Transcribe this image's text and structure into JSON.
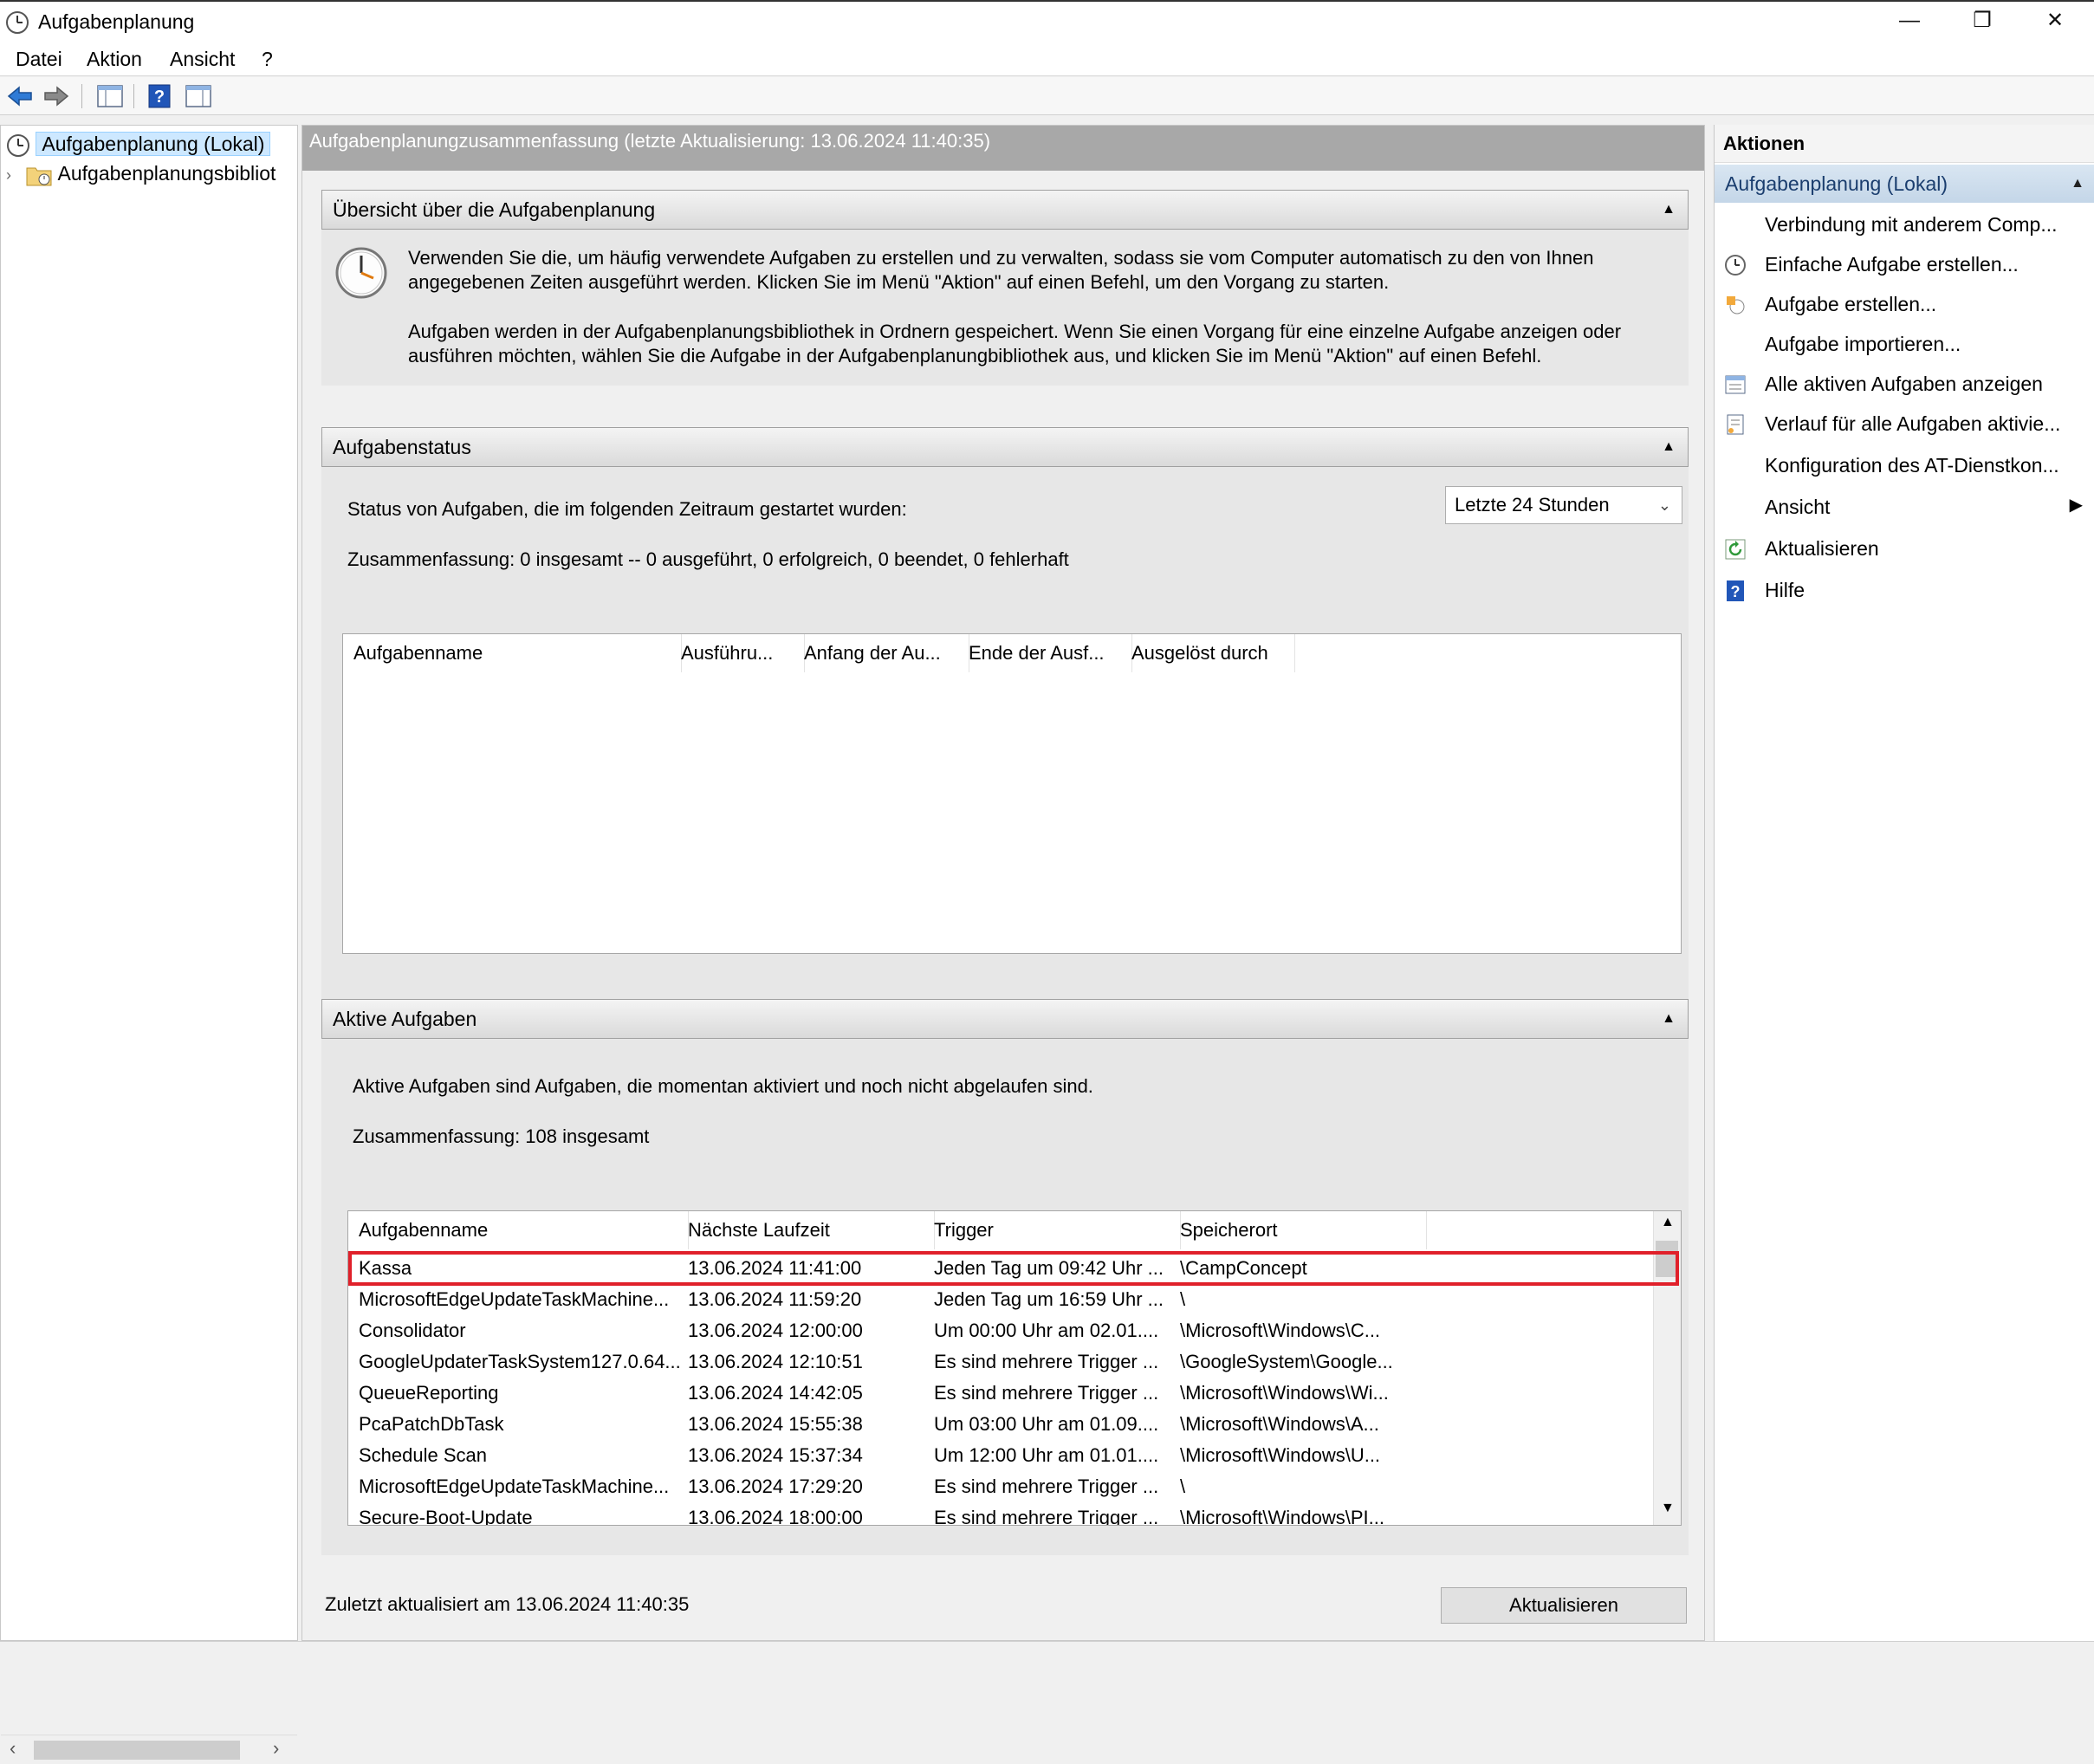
{
  "window": {
    "title": "Aufgabenplanung",
    "minimize": "—",
    "maximize": "❐",
    "close": "✕"
  },
  "menu": [
    "Datei",
    "Aktion",
    "Ansicht",
    "?"
  ],
  "tree": {
    "root": "Aufgabenplanung (Lokal)",
    "library": "Aufgabenplanungsbibliot"
  },
  "center": {
    "header": "Aufgabenplanungzusammenfassung (letzte Aktualisierung: 13.06.2024 11:40:35)",
    "overview": {
      "title": "Übersicht über die Aufgabenplanung",
      "text1a": "Verwenden Sie die, um häufig verwendete Aufgaben zu erstellen und zu verwalten, sodass sie vom Computer automatisch zu den von Ihnen",
      "text1b": "angegebenen Zeiten ausgeführt werden. Klicken Sie im Menü \"Aktion\" auf einen Befehl, um den Vorgang zu starten.",
      "text2a": "Aufgaben werden in der Aufgabenplanungsbibliothek in Ordnern gespeichert. Wenn Sie einen Vorgang für eine einzelne Aufgabe anzeigen oder",
      "text2b": "ausführen möchten, wählen Sie die Aufgabe in der Aufgabenplanungbibliothek aus, und klicken Sie im Menü \"Aktion\" auf einen Befehl."
    },
    "status": {
      "title": "Aufgabenstatus",
      "period_label": "Status von Aufgaben, die im folgenden Zeitraum gestartet wurden:",
      "period_value": "Letzte 24 Stunden",
      "summary": "Zusammenfassung: 0 insgesamt -- 0 ausgeführt, 0 erfolgreich, 0 beendet, 0 fehlerhaft",
      "columns": [
        "Aufgabenname",
        "Ausführu...",
        "Anfang der Au...",
        "Ende der Ausf...",
        "Ausgelöst durch"
      ]
    },
    "active": {
      "title": "Aktive Aufgaben",
      "desc": "Aktive Aufgaben sind Aufgaben, die momentan aktiviert und noch nicht abgelaufen sind.",
      "summary": "Zusammenfassung: 108 insgesamt",
      "columns": [
        "Aufgabenname",
        "Nächste Laufzeit",
        "Trigger",
        "Speicherort"
      ],
      "rows": [
        [
          "Kassa",
          "13.06.2024 11:41:00",
          "Jeden Tag um 09:42 Uhr ...",
          "\\CampConcept"
        ],
        [
          "MicrosoftEdgeUpdateTaskMachine...",
          "13.06.2024 11:59:20",
          "Jeden Tag um 16:59 Uhr ...",
          "\\"
        ],
        [
          "Consolidator",
          "13.06.2024 12:00:00",
          "Um 00:00 Uhr am 02.01....",
          "\\Microsoft\\Windows\\C..."
        ],
        [
          "GoogleUpdaterTaskSystem127.0.64...",
          "13.06.2024 12:10:51",
          "Es sind mehrere Trigger ...",
          "\\GoogleSystem\\Google..."
        ],
        [
          "QueueReporting",
          "13.06.2024 14:42:05",
          "Es sind mehrere Trigger ...",
          "\\Microsoft\\Windows\\Wi..."
        ],
        [
          "PcaPatchDbTask",
          "13.06.2024 15:55:38",
          "Um 03:00 Uhr am 01.09....",
          "\\Microsoft\\Windows\\A..."
        ],
        [
          "Schedule Scan",
          "13.06.2024 15:37:34",
          "Um 12:00 Uhr am 01.01....",
          "\\Microsoft\\Windows\\U..."
        ],
        [
          "MicrosoftEdgeUpdateTaskMachine...",
          "13.06.2024 17:29:20",
          "Es sind mehrere Trigger ...",
          "\\"
        ],
        [
          "Secure-Boot-Update",
          "13.06.2024 18:00:00",
          "Es sind mehrere Trigger ...",
          "\\Microsoft\\Windows\\PI..."
        ]
      ]
    },
    "footer": {
      "last_updated": "Zuletzt aktualisiert am 13.06.2024 11:40:35",
      "refresh_button": "Aktualisieren"
    }
  },
  "actions": {
    "title": "Aktionen",
    "group": "Aufgabenplanung (Lokal)",
    "items": [
      {
        "label": "Verbindung mit anderem Comp...",
        "icon": ""
      },
      {
        "label": "Einfache Aufgabe erstellen...",
        "icon": "wizard-clock-icon"
      },
      {
        "label": "Aufgabe erstellen...",
        "icon": "task-create-icon"
      },
      {
        "label": "Aufgabe importieren...",
        "icon": ""
      },
      {
        "label": "Alle aktiven Aufgaben anzeigen",
        "icon": "list-icon"
      },
      {
        "label": "Verlauf für alle Aufgaben aktivie...",
        "icon": "history-icon"
      },
      {
        "label": "Konfiguration des AT-Dienstkon...",
        "icon": ""
      },
      {
        "label": "Ansicht",
        "icon": "submenu-arrow-icon"
      },
      {
        "label": "Aktualisieren",
        "icon": "refresh-icon"
      },
      {
        "label": "Hilfe",
        "icon": "help-icon"
      }
    ]
  },
  "colors": {
    "selection_highlight": "#e0202a",
    "accent_blue": "#1e5fb4"
  }
}
